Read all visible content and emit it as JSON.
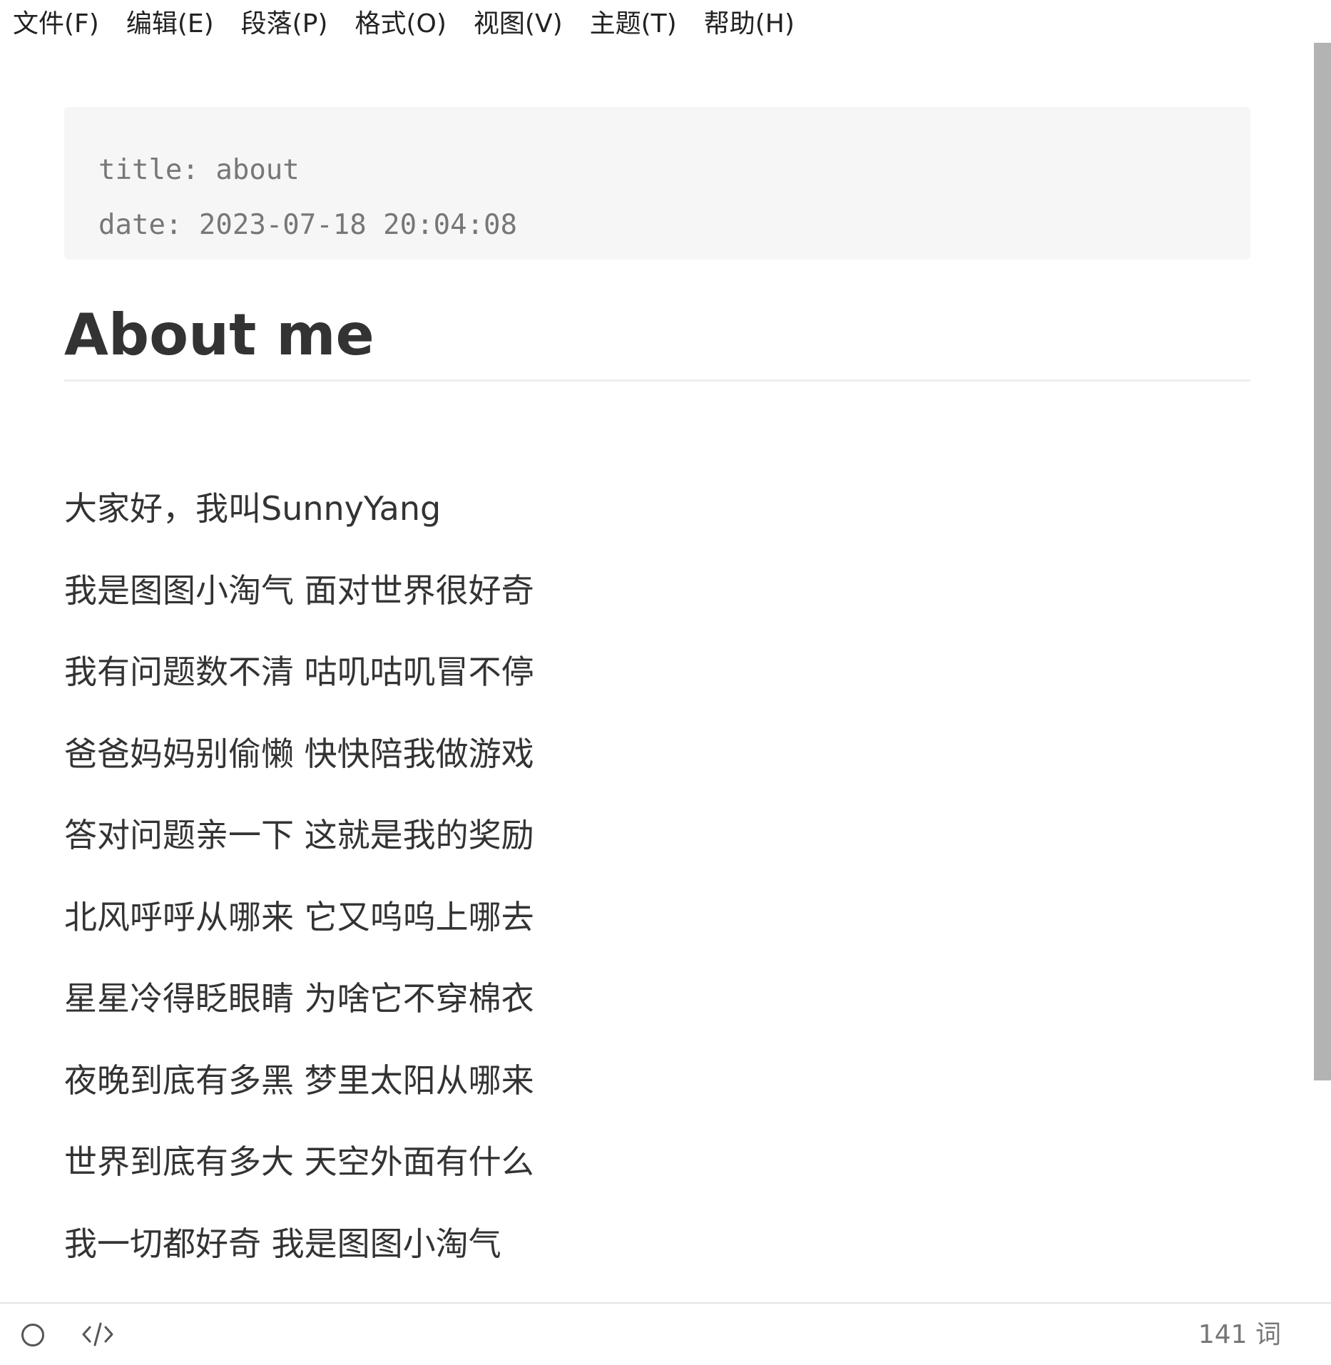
{
  "menubar": {
    "items": [
      {
        "label": "文件(F)"
      },
      {
        "label": "编辑(E)"
      },
      {
        "label": "段落(P)"
      },
      {
        "label": "格式(O)"
      },
      {
        "label": "视图(V)"
      },
      {
        "label": "主题(T)"
      },
      {
        "label": "帮助(H)"
      }
    ]
  },
  "document": {
    "frontmatter": {
      "line1": "title: about",
      "line2": "date: 2023-07-18 20:04:08"
    },
    "heading": "About me",
    "paragraphs": [
      "大家好，我叫SunnyYang",
      "我是图图小淘气 面对世界很好奇",
      "我有问题数不清 咕叽咕叽冒不停",
      "爸爸妈妈别偷懒 快快陪我做游戏",
      "答对问题亲一下 这就是我的奖励",
      "北风呼呼从哪来 它又呜呜上哪去",
      "星星冷得眨眼睛 为啥它不穿棉衣",
      "夜晚到底有多黑 梦里太阳从哪来",
      "世界到底有多大 天空外面有什么",
      "我一切都好奇 我是图图小淘气"
    ]
  },
  "statusbar": {
    "outline_icon": "circle-icon",
    "source_icon": "code-icon",
    "word_count": "141 词"
  },
  "colors": {
    "text": "#333333",
    "frontmatter_bg": "#f6f6f6",
    "frontmatter_text": "#777777",
    "scrollbar_thumb": "#b3b3b3"
  }
}
